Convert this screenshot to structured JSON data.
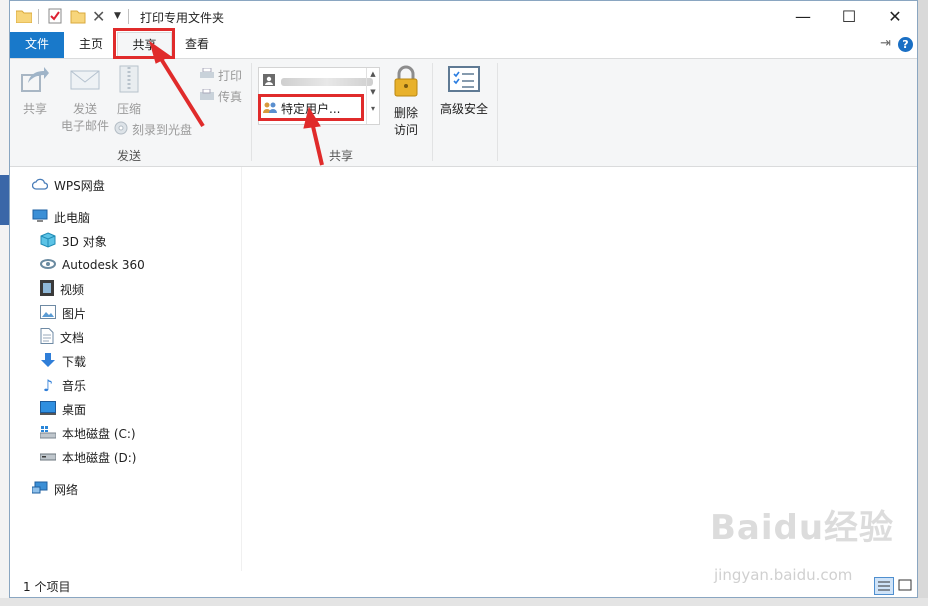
{
  "window": {
    "title": "打印专用文件夹",
    "controls": {
      "minimize": "—",
      "maximize": "☐",
      "close": "✕"
    }
  },
  "tabs": {
    "file": "文件",
    "home": "主页",
    "share": "共享",
    "view": "查看"
  },
  "ribbon": {
    "send_group": {
      "label": "发送",
      "share": "共享",
      "email_line1": "发送",
      "email_line2": "电子邮件",
      "zip": "压缩",
      "print": "打印",
      "fax": "传真",
      "burn": "刻录到光盘"
    },
    "share_group": {
      "label": "共享",
      "specific_users": "特定用户...",
      "remove_line1": "删除",
      "remove_line2": "访问"
    },
    "advanced_security": "高级安全"
  },
  "nav": {
    "wps": "WPS网盘",
    "this_pc": "此电脑",
    "objects3d": "3D 对象",
    "autodesk": "Autodesk 360",
    "videos": "视频",
    "pictures": "图片",
    "documents": "文档",
    "downloads": "下载",
    "music": "音乐",
    "desktop": "桌面",
    "disk_c": "本地磁盘 (C:)",
    "disk_d": "本地磁盘 (D:)",
    "network": "网络"
  },
  "status": {
    "items": "1 个项目"
  },
  "watermark": {
    "brand": "Baidu经验",
    "url": "jingyan.baidu.com"
  },
  "colors": {
    "accent": "#1979ca",
    "annotation": "#e02b2b"
  }
}
